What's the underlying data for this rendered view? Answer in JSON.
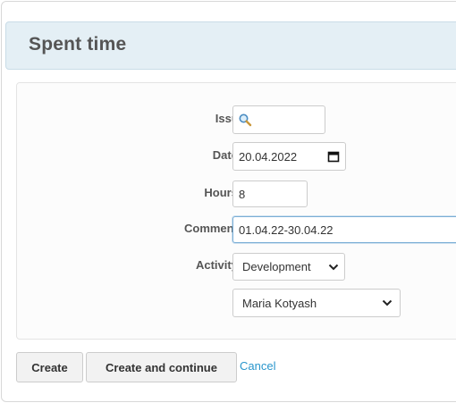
{
  "page": {
    "title": "Spent time"
  },
  "form": {
    "issue": {
      "label": "Issue",
      "value": ""
    },
    "date": {
      "label": "Date",
      "required": "*",
      "value": "20.04.2022"
    },
    "hours": {
      "label": "Hours",
      "required": "*",
      "value": "8"
    },
    "comment": {
      "label": "Comment",
      "required": "*",
      "value": "01.04.22-30.04.22"
    },
    "activity": {
      "label": "Activity",
      "required": "*",
      "value": "Development"
    },
    "user": {
      "value": "Maria Kotyash"
    }
  },
  "actions": {
    "create_label": "Create",
    "create_continue_label": "Create and continue",
    "cancel_label": "Cancel"
  },
  "colors": {
    "title_bar_bg": "#e4eff5",
    "required_mark": "#cc3333",
    "link": "#2996cc"
  },
  "icons": {
    "issue_search": "search-icon",
    "date_picker": "calendar-icon",
    "select_arrow": "chevron-down-icon"
  }
}
